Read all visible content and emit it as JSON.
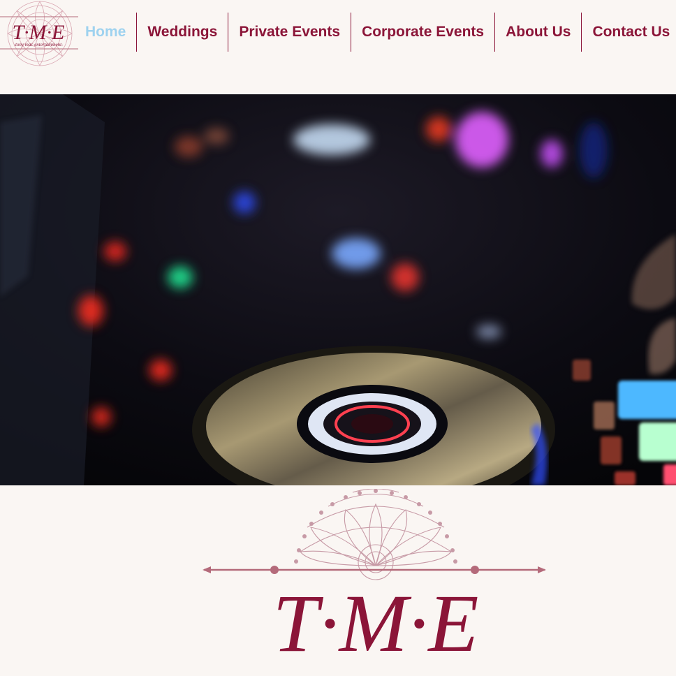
{
  "brand": {
    "monogram": "T·M·E",
    "tagline": "-tony mac entertainment-"
  },
  "nav": {
    "items": [
      {
        "label": "Home",
        "active": true
      },
      {
        "label": "Weddings",
        "active": false
      },
      {
        "label": "Private Events",
        "active": false
      },
      {
        "label": "Corporate Events",
        "active": false
      },
      {
        "label": "About Us",
        "active": false
      },
      {
        "label": "Contact Us",
        "active": false
      }
    ]
  },
  "hero": {
    "image": "dj-controller-icon"
  },
  "colors": {
    "brand": "#8b1538",
    "active_nav": "#9ed2ef",
    "background": "#faf6f3",
    "logo_line": "#b46a7a"
  }
}
